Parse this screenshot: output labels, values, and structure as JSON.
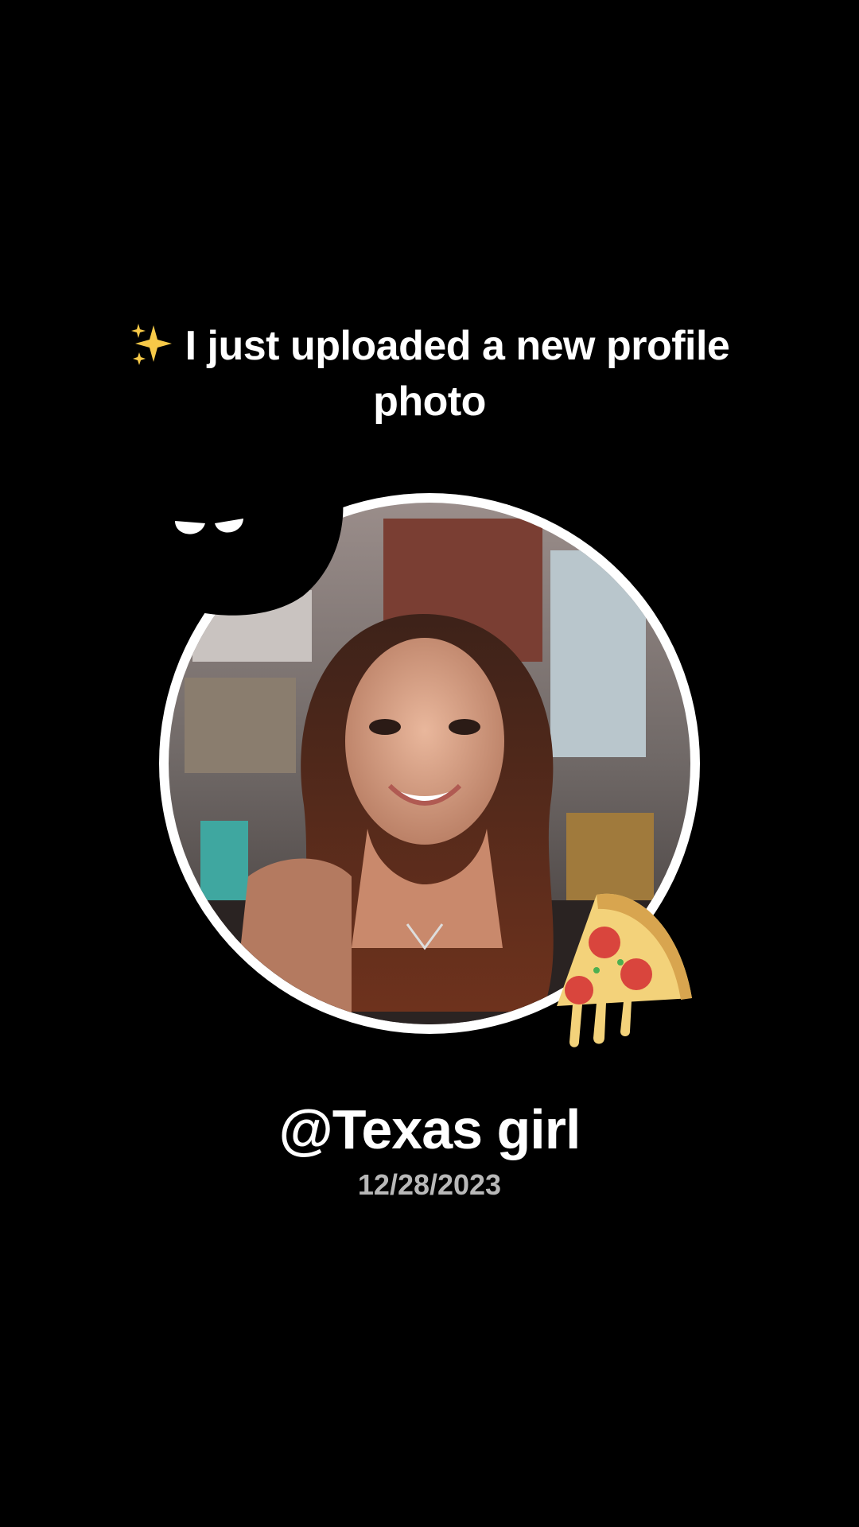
{
  "headline": {
    "icon": "sparkles-icon",
    "text": "I just uploaded a new profile photo"
  },
  "profile": {
    "username": "@Texas girl",
    "date": "12/28/2023"
  },
  "stickers": {
    "top_left": "peeking-eyes-icon",
    "bottom_right": "pizza-icon"
  },
  "colors": {
    "background": "#000000",
    "text": "#ffffff",
    "date_text": "#b8b8b8",
    "ring": "#ffffff"
  }
}
